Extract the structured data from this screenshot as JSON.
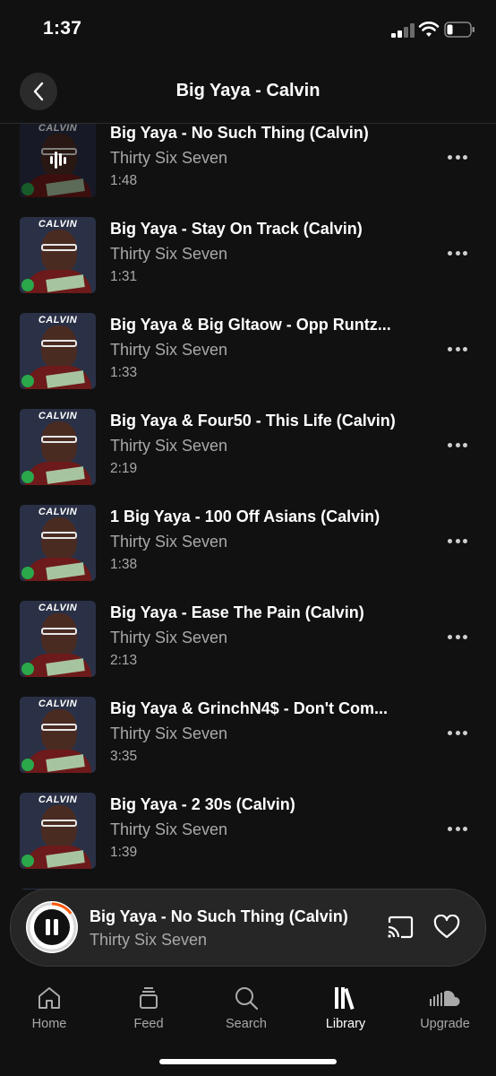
{
  "status": {
    "time": "1:37"
  },
  "header": {
    "title": "Big Yaya - Calvin"
  },
  "artwork_logo": "CALVIN",
  "tracks": [
    {
      "title": "Big Yaya - No Such Thing (Calvin)",
      "artist": "Thirty Six Seven",
      "duration": "1:48",
      "playing": true
    },
    {
      "title": "Big Yaya - Stay On Track (Calvin)",
      "artist": "Thirty Six Seven",
      "duration": "1:31"
    },
    {
      "title": "Big Yaya & Big Gltaow - Opp Runtz...",
      "artist": "Thirty Six Seven",
      "duration": "1:33"
    },
    {
      "title": "Big Yaya & Four50 - This Life (Calvin)",
      "artist": "Thirty Six Seven",
      "duration": "2:19"
    },
    {
      "title": "1 Big Yaya - 100 Off Asians (Calvin)",
      "artist": "Thirty Six Seven",
      "duration": "1:38"
    },
    {
      "title": "Big Yaya - Ease The Pain (Calvin)",
      "artist": "Thirty Six Seven",
      "duration": "2:13"
    },
    {
      "title": "Big Yaya & GrinchN4$ - Don't Com...",
      "artist": "Thirty Six Seven",
      "duration": "3:35"
    },
    {
      "title": "Big Yaya - 2 30s (Calvin)",
      "artist": "Thirty Six Seven",
      "duration": "1:39"
    }
  ],
  "mini_player": {
    "title": "Big Yaya - No Such Thing (Calvin)",
    "artist": "Thirty Six Seven",
    "progress": 0.15,
    "accent": "#ff5500"
  },
  "tabs": [
    {
      "label": "Home",
      "icon": "home-icon"
    },
    {
      "label": "Feed",
      "icon": "feed-icon"
    },
    {
      "label": "Search",
      "icon": "search-icon"
    },
    {
      "label": "Library",
      "icon": "library-icon",
      "active": true
    },
    {
      "label": "Upgrade",
      "icon": "soundcloud-icon"
    }
  ]
}
